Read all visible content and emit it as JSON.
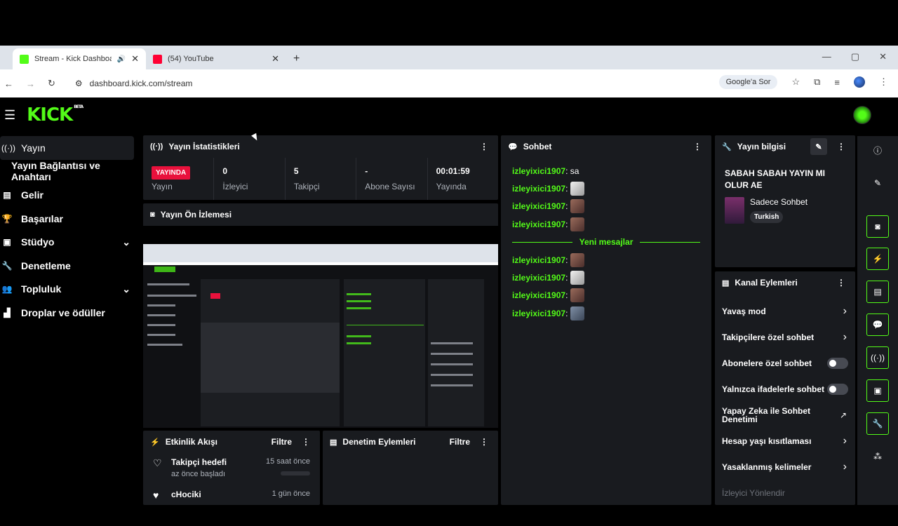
{
  "browser": {
    "tabs": [
      {
        "title": "Stream - Kick Dashboard",
        "favicon_color": "#53fc18"
      },
      {
        "title": "(54) YouTube",
        "favicon_color": "#ff0033"
      }
    ],
    "url": "dashboard.kick.com/stream",
    "google_btn": "Google'a Sor"
  },
  "app": {
    "logo": "KICK",
    "beta": "BETA"
  },
  "sidebar": {
    "items": [
      {
        "label": "Yayın",
        "icon": "broadcast-icon"
      },
      {
        "label": "Yayın Bağlantısı ve Anahtarı"
      },
      {
        "label": "Gelir",
        "icon": "chart-icon"
      },
      {
        "label": "Başarılar",
        "icon": "trophy-icon"
      },
      {
        "label": "Stüdyo",
        "icon": "studio-icon"
      },
      {
        "label": "Denetleme",
        "icon": "wrench-icon"
      },
      {
        "label": "Topluluk",
        "icon": "people-icon"
      },
      {
        "label": "Droplar ve ödüller",
        "icon": "gift-icon"
      }
    ]
  },
  "stats": {
    "title": "Yayın İstatistikleri",
    "live_badge": "YAYINDA",
    "items": [
      {
        "value": "",
        "label": "Yayın"
      },
      {
        "value": "0",
        "label": "İzleyici"
      },
      {
        "value": "5",
        "label": "Takipçi"
      },
      {
        "value": "-",
        "label": "Abone Sayısı"
      },
      {
        "value": "00:01:59",
        "label": "Yayında"
      }
    ]
  },
  "preview": {
    "title": "Yayın Ön İzlemesi"
  },
  "chat": {
    "title": "Sohbet",
    "messages": [
      {
        "user": "izleyixici1907",
        "text": "sa",
        "emote": ""
      },
      {
        "user": "izleyixici1907",
        "text": "",
        "emote": "white"
      },
      {
        "user": "izleyixici1907",
        "text": "",
        "emote": "face"
      },
      {
        "user": "izleyixici1907",
        "text": "",
        "emote": "face"
      }
    ],
    "new_messages_label": "Yeni mesajlar",
    "new_messages": [
      {
        "user": "izleyixici1907",
        "text": "",
        "emote": "face"
      },
      {
        "user": "izleyixici1907",
        "text": "",
        "emote": "white"
      },
      {
        "user": "izleyixici1907",
        "text": "",
        "emote": "face"
      },
      {
        "user": "izleyixici1907",
        "text": "",
        "emote": "blue"
      }
    ]
  },
  "info": {
    "title": "Yayın bilgisi",
    "stream_title": "SABAH SABAH YAYIN MI OLUR AE",
    "category": "Sadece Sohbet",
    "tag": "Turkish"
  },
  "channel_actions": {
    "title": "Kanal Eylemleri",
    "items": [
      {
        "label": "Yavaş mod",
        "control": "arrow"
      },
      {
        "label": "Takipçilere özel sohbet",
        "control": "arrow"
      },
      {
        "label": "Abonelere özel sohbet",
        "control": "toggle"
      },
      {
        "label": "Yalnızca ifadelerle sohbet",
        "control": "toggle"
      },
      {
        "label": "Yapay Zeka ile Sohbet Denetimi",
        "control": "external"
      },
      {
        "label": "Hesap yaşı kısıtlaması",
        "control": "arrow"
      },
      {
        "label": "Yasaklanmış kelimeler",
        "control": "arrow"
      },
      {
        "label": "İzleyici Yönlendir",
        "control": "none"
      }
    ]
  },
  "activity": {
    "title": "Etkinlik Akışı",
    "filter": "Filtre",
    "items": [
      {
        "title": "Takipçi hedefi",
        "sub": "az önce başladı",
        "time": "15 saat önce",
        "icon": "heart-icon"
      },
      {
        "title": "cHociki",
        "sub": "",
        "time": "1 gün önce",
        "icon": "heart-icon"
      }
    ]
  },
  "moderation": {
    "title": "Denetim Eylemleri",
    "filter": "Filtre"
  },
  "colors": {
    "accent": "#53fc18",
    "live": "#e9113c",
    "panel": "#191b1f"
  }
}
